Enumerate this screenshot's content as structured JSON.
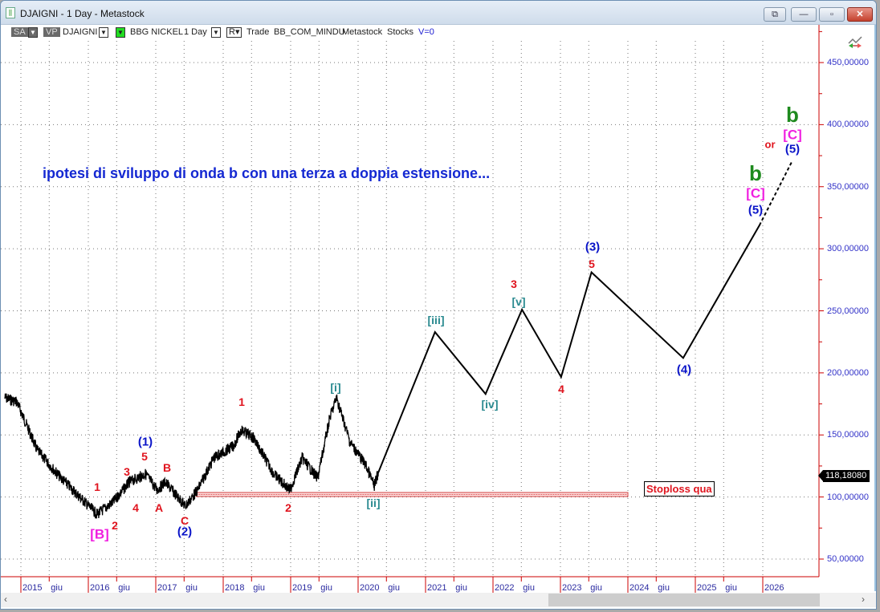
{
  "window": {
    "title": "DJAIGNI - 1 Day - Metastock",
    "buttons": {
      "restore": "⧉",
      "minimize": "—",
      "maximize": "▫",
      "close": "✕"
    }
  },
  "toolbar": {
    "sa": "SA",
    "vp": "VP",
    "symbol": "DJAIGNI",
    "name": "BBG NICKEL",
    "period": "1 Day",
    "r": "R",
    "trade": "Trade",
    "account": "BB_COM_MINDU",
    "source": "Metastock",
    "type": "Stocks",
    "v": "V=0"
  },
  "annotation": "ipotesi di sviluppo di onda b con una terza a doppia estensione...",
  "stoploss": {
    "label": "Stoploss qua",
    "price": 102,
    "from": 2017.6,
    "to": 2024.0
  },
  "current_price": "118,18080",
  "colors": {
    "axis": "#cc0000",
    "price": "#000000",
    "stoploss": "#e05050",
    "label_blue": "#0a14c8",
    "label_red": "#e0141e"
  },
  "wave_labels": [
    "1",
    "2",
    "3",
    "4",
    "5",
    "(1)",
    "B",
    "A",
    "C",
    "(2)",
    "[B]",
    "1",
    "2",
    "[i]",
    "[ii]",
    "[iii]",
    "[iv]",
    "[v]",
    "3",
    "4",
    "5",
    "(3)",
    "(4)",
    "b",
    "[C]",
    "(5)",
    "or",
    "b",
    "[C]",
    "(5)"
  ],
  "chart_data": {
    "type": "line",
    "title": "DJAIGNI - 1 Day",
    "xlabel": "",
    "ylabel": "",
    "ylim": [
      20,
      470
    ],
    "xlim": [
      2014.7,
      2026.85
    ],
    "y_ticks": [
      "450,00000",
      "400,00000",
      "350,00000",
      "300,00000",
      "250,00000",
      "200,00000",
      "150,00000",
      "100,00000",
      "50,00000"
    ],
    "y_tick_values": [
      450,
      400,
      350,
      300,
      250,
      200,
      150,
      100,
      50
    ],
    "x_ticks": [
      "2015",
      "giu",
      "2016",
      "giu",
      "2017",
      "giu",
      "2018",
      "giu",
      "2019",
      "giu",
      "2020",
      "giu",
      "2021",
      "giu",
      "2022",
      "giu",
      "2023",
      "giu",
      "2024",
      "giu",
      "2025",
      "giu",
      "2026"
    ],
    "x_tick_values": [
      2015,
      2015.42,
      2016,
      2016.42,
      2017,
      2017.42,
      2018,
      2018.42,
      2019,
      2019.42,
      2020,
      2020.42,
      2021,
      2021.42,
      2022,
      2022.42,
      2023,
      2023.42,
      2024,
      2024.42,
      2025,
      2025.42,
      2026
    ],
    "series": [
      {
        "name": "DJAIGNI price",
        "x": [
          2014.76,
          2014.94,
          2015.24,
          2015.54,
          2015.89,
          2016.13,
          2016.37,
          2016.61,
          2016.85,
          2017.02,
          2017.14,
          2017.44,
          2017.62,
          2017.86,
          2018.15,
          2018.27,
          2018.45,
          2018.75,
          2018.99,
          2019.17,
          2019.4,
          2019.58,
          2019.68,
          2019.88,
          2020.12,
          2020.24,
          2020.3
        ],
        "y": [
          180,
          176.7,
          138,
          118.5,
          99,
          86,
          96,
          112,
          118.5,
          105.6,
          112,
          92.6,
          105.6,
          131.4,
          141,
          154,
          147.6,
          118.5,
          105.6,
          131.4,
          115,
          163.7,
          180,
          144.3,
          125,
          108.8,
          119.8
        ]
      },
      {
        "name": "Projection",
        "x": [
          2020.3,
          2021.14,
          2021.89,
          2022.43,
          2023.01,
          2023.46,
          2024.82,
          2025.95
        ],
        "y": [
          119.8,
          232.9,
          183,
          251,
          196.7,
          281,
          212,
          318.8
        ]
      },
      {
        "name": "Projection extension (dashed)",
        "x": [
          2025.95,
          2026.43
        ],
        "y": [
          318.8,
          370
        ]
      }
    ]
  }
}
